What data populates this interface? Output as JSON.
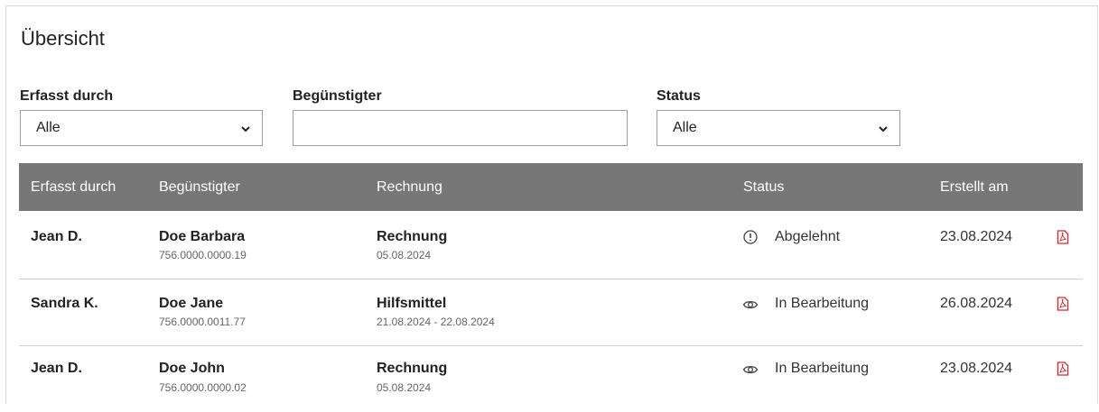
{
  "page": {
    "title": "Übersicht"
  },
  "filters": {
    "erfasst_label": "Erfasst durch",
    "erfasst_value": "Alle",
    "beguenstigter_label": "Begünstigter",
    "beguenstigter_value": "",
    "status_label": "Status",
    "status_value": "Alle"
  },
  "table": {
    "headers": [
      "Erfasst durch",
      "Begünstigter",
      "Rechnung",
      "Status",
      "Erstellt am"
    ],
    "rows": [
      {
        "erfasst": "Jean D.",
        "name": "Doe Barbara",
        "ahv": "756.0000.0000.19",
        "rechnung": "Rechnung",
        "datum": "05.08.2024",
        "status": "Abgelehnt",
        "status_icon": "exclamation-circle-icon",
        "erstellt": "23.08.2024"
      },
      {
        "erfasst": "Sandra K.",
        "name": "Doe Jane",
        "ahv": "756.0000.0011.77",
        "rechnung": "Hilfsmittel",
        "datum": "21.08.2024 - 22.08.2024",
        "status": "In Bearbeitung",
        "status_icon": "eye-icon",
        "erstellt": "26.08.2024"
      },
      {
        "erfasst": "Jean D.",
        "name": "Doe John",
        "ahv": "756.0000.0000.02",
        "rechnung": "Rechnung",
        "datum": "05.08.2024",
        "status": "In Bearbeitung",
        "status_icon": "eye-icon",
        "erstellt": "23.08.2024"
      }
    ]
  },
  "colors": {
    "header_bg": "#777777",
    "pdf_red": "#d9242b",
    "border": "#9aa29a"
  }
}
